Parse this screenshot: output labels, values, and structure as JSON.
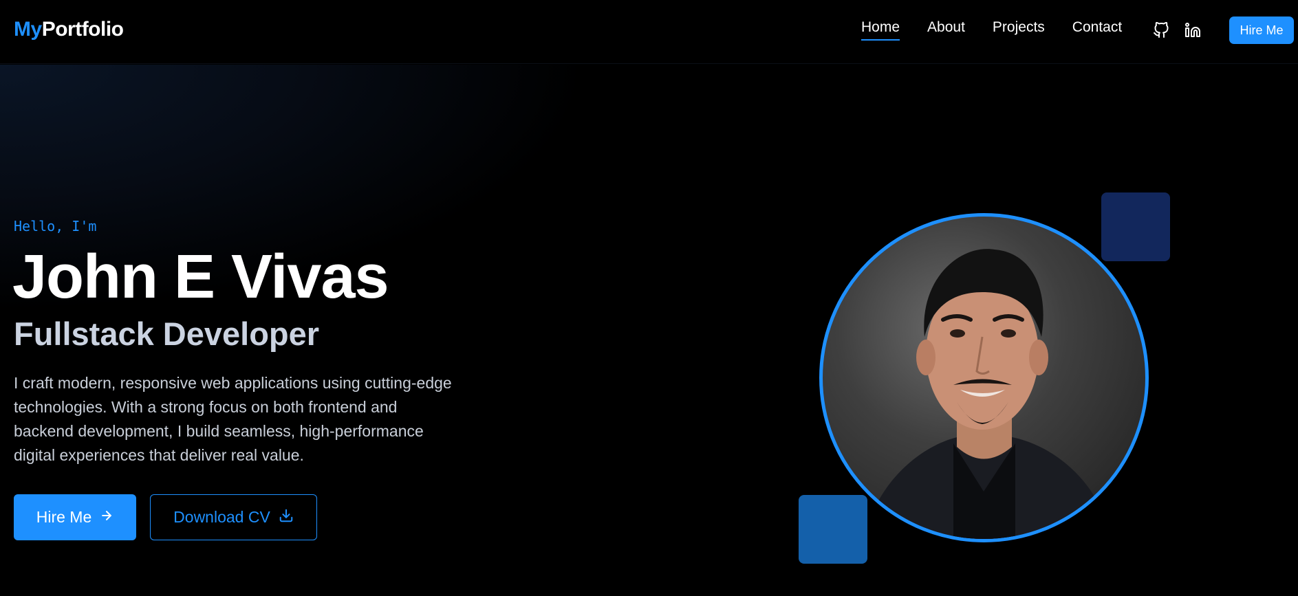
{
  "navbar": {
    "logo_accent": "My",
    "logo_rest": "Portfolio",
    "links": [
      {
        "label": "Home"
      },
      {
        "label": "About"
      },
      {
        "label": "Projects"
      },
      {
        "label": "Contact"
      }
    ],
    "icons": [
      "github-icon",
      "linkedin-icon"
    ],
    "cta_label": "Hire Me"
  },
  "hero": {
    "greeting": "Hello, I'm",
    "name": "John E Vivas",
    "role": "Fullstack Developer",
    "description": "I craft modern, responsive web applications using cutting-edge technologies. With a strong focus on both frontend and backend development, I build seamless, high-performance digital experiences that deliver real value.",
    "primary_button": "Hire Me",
    "primary_button_icon": "arrow-right-icon",
    "secondary_button": "Download CV",
    "secondary_button_icon": "download-icon"
  },
  "colors": {
    "accent": "#1e90ff",
    "background": "#000000",
    "deco_dark": "#12275c",
    "deco_mid": "#1460aa"
  }
}
